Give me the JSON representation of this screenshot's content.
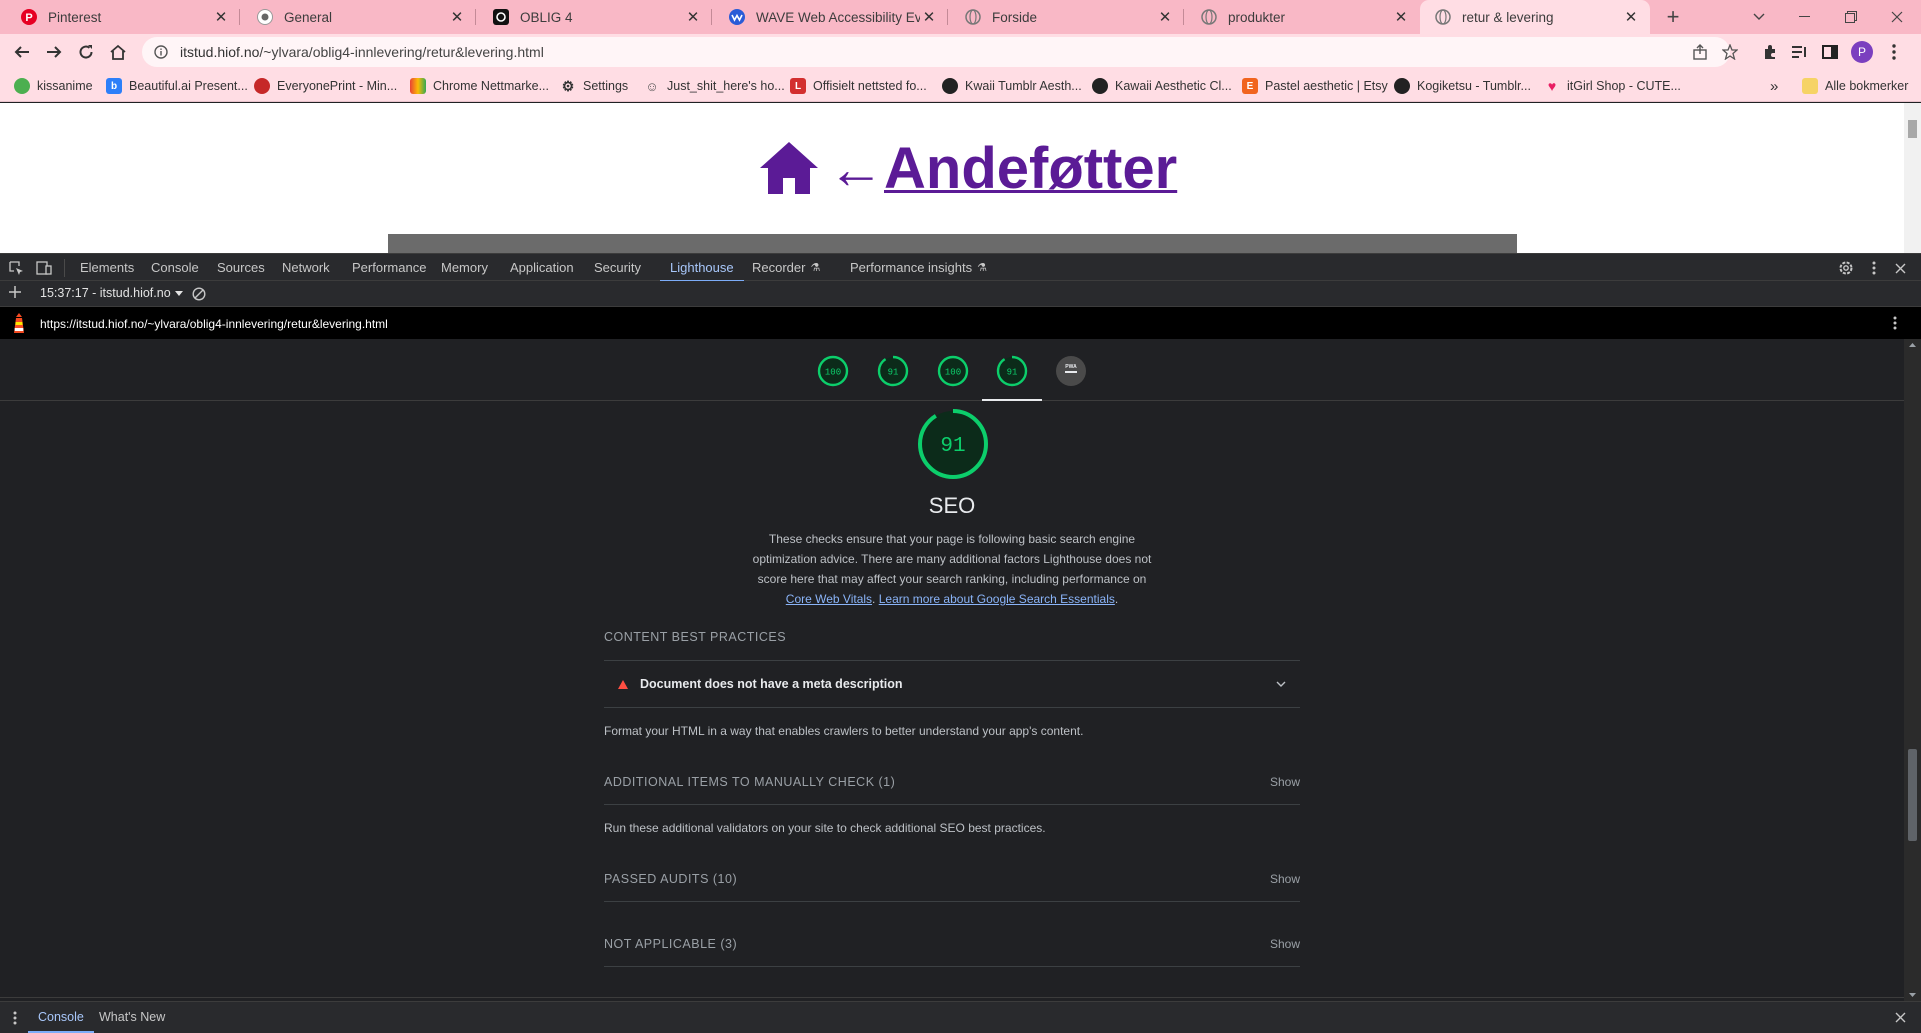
{
  "browser": {
    "tabs": [
      {
        "title": "Pinterest",
        "icon": "pinterest-icon",
        "active": false
      },
      {
        "title": "General",
        "icon": "github-icon",
        "active": false
      },
      {
        "title": "OBLIG 4",
        "icon": "threads-icon",
        "active": false
      },
      {
        "title": "WAVE Web Accessibility Evaluat",
        "icon": "wave-icon",
        "active": false
      },
      {
        "title": "Forside",
        "icon": "globe-icon",
        "active": false
      },
      {
        "title": "produkter",
        "icon": "globe-icon",
        "active": false
      },
      {
        "title": "retur & levering",
        "icon": "globe-icon",
        "active": true
      }
    ],
    "close_glyph": "✕",
    "new_tab_glyph": "+",
    "address": {
      "host": "itstud.hiof.no",
      "path": "/~ylvara/oblig4-innlevering/retur&levering.html"
    },
    "profile_initial": "P",
    "bookmarks": [
      {
        "label": "kissanime",
        "icon": "kissanime-icon",
        "color": "#4caf50"
      },
      {
        "label": "Beautiful.ai Present...",
        "icon": "beautifulai-icon",
        "color": "#2d7ff9"
      },
      {
        "label": "EveryonePrint - Min...",
        "icon": "everyoneprint-icon",
        "color": "#c62828"
      },
      {
        "label": "Chrome Nettmarke...",
        "icon": "chrome-webstore-icon",
        "color": "#f4b400"
      },
      {
        "label": "Settings",
        "icon": "gear-icon",
        "color": "#333333"
      },
      {
        "label": "Just_shit_here's ho...",
        "icon": "emoji-icon",
        "color": "#777777"
      },
      {
        "label": "Offisielt nettsted fo...",
        "icon": "letter-l-icon",
        "color": "#d32f2f"
      },
      {
        "label": "Kwaii Tumblr Aesth...",
        "icon": "tumblr-icon",
        "color": "#222222"
      },
      {
        "label": "Kawaii Aesthetic Cl...",
        "icon": "tumblr-icon",
        "color": "#222222"
      },
      {
        "label": "Pastel aesthetic | Etsy",
        "icon": "etsy-icon",
        "color": "#f1641e"
      },
      {
        "label": "Kogiketsu - Tumblr...",
        "icon": "tumblr-icon",
        "color": "#222222"
      },
      {
        "label": "itGirl Shop - CUTE...",
        "icon": "heart-icon",
        "color": "#e91e63"
      }
    ],
    "bookmarks_overflow": "»",
    "all_bookmarks": "Alle bokmerker"
  },
  "page": {
    "arrow": "←",
    "title": "Andeføtter"
  },
  "devtools": {
    "tabs": [
      "Elements",
      "Console",
      "Sources",
      "Network",
      "Performance",
      "Memory",
      "Application",
      "Security",
      "Lighthouse",
      "Recorder",
      "Performance insights"
    ],
    "active_tab": "Lighthouse",
    "report_label": "15:37:17 - itstud.hiof.no",
    "report_url": "https://itstud.hiof.no/~ylvara/oblig4-innlevering/retur&levering.html",
    "scores": [
      {
        "value": 100,
        "label": "100",
        "color": "#0cce6b"
      },
      {
        "value": 91,
        "label": "91",
        "color": "#0cce6b"
      },
      {
        "value": 100,
        "label": "100",
        "color": "#0cce6b"
      },
      {
        "value": 91,
        "label": "91",
        "color": "#0cce6b"
      }
    ],
    "pwa_label": "PWA",
    "seo": {
      "score": 91,
      "score_label": "91",
      "title": "SEO",
      "description": "These checks ensure that your page is following basic search engine optimization advice. There are many additional factors Lighthouse does not score here that may affect your search ranking, including performance on",
      "link1": "Core Web Vitals",
      "link_sep": ". ",
      "link2": "Learn more about Google Search Essentials",
      "link_end": "."
    },
    "groups": {
      "content_best_practices": {
        "title": "CONTENT BEST PRACTICES",
        "failed_audit": "Document does not have a meta description",
        "description": "Format your HTML in a way that enables crawlers to better understand your app's content."
      },
      "manual": {
        "title": "ADDITIONAL ITEMS TO MANUALLY CHECK (1)",
        "show": "Show",
        "description": "Run these additional validators on your site to check additional SEO best practices."
      },
      "passed": {
        "title": "PASSED AUDITS (10)",
        "show": "Show"
      },
      "not_applicable": {
        "title": "NOT APPLICABLE (3)",
        "show": "Show"
      }
    },
    "drawer": {
      "tabs": [
        "Console",
        "What's New"
      ],
      "active": "Console"
    },
    "colors": {
      "pass": "#0cce6b",
      "fail": "#ff4e42",
      "link": "#8ab4f8"
    }
  }
}
